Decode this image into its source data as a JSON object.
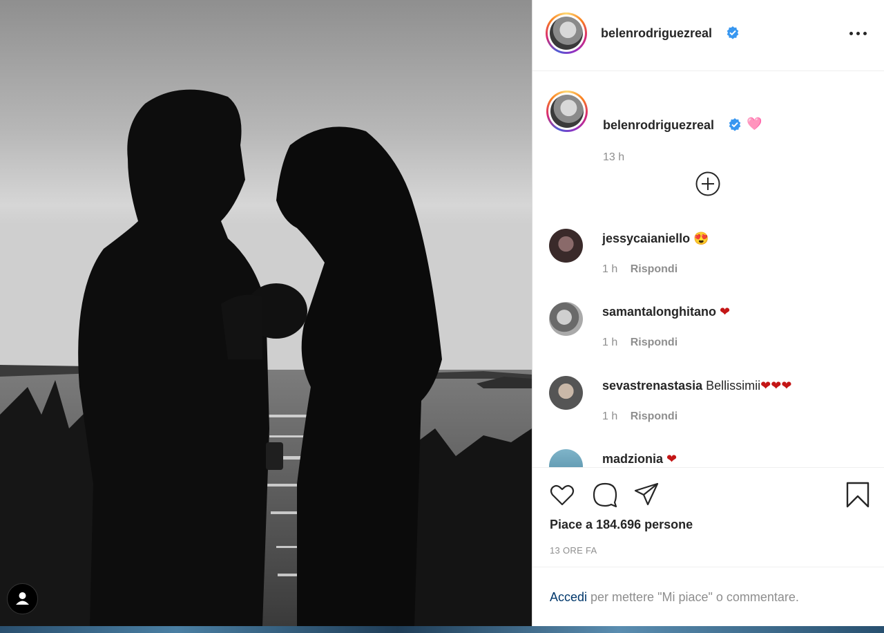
{
  "post": {
    "author": "belenrodriguezreal",
    "verified": true,
    "caption_emoji": "🩷",
    "caption_time": "13 h",
    "comments": [
      {
        "username": "jessycaianiello",
        "text": "😍",
        "time": "1 h",
        "reply": "Rispondi"
      },
      {
        "username": "samantalonghitano",
        "text": "❤",
        "time": "1 h",
        "reply": "Rispondi"
      },
      {
        "username": "sevastrenastasia",
        "text": "Bellissimii❤❤❤",
        "time": "1 h",
        "reply": "Rispondi"
      },
      {
        "username": "madzionia",
        "text": "❤",
        "time": "",
        "reply": ""
      }
    ],
    "likes_text": "Piace a 184.696 persone",
    "time_ago": "13 ORE FA",
    "login_link": "Accedi",
    "login_rest": " per mettere \"Mi piace\" o commentare."
  },
  "icons": {
    "more": "more-options-icon",
    "load_more": "plus-circle-icon",
    "like": "heart-icon",
    "comment": "comment-bubble-icon",
    "share": "paper-plane-icon",
    "save": "bookmark-icon",
    "verified": "verified-badge-icon",
    "user_tag": "user-tag-icon"
  },
  "colors": {
    "verified": "#3897f0",
    "heart": "#c41616",
    "link": "#00376b",
    "meta": "#8e8e8e"
  }
}
